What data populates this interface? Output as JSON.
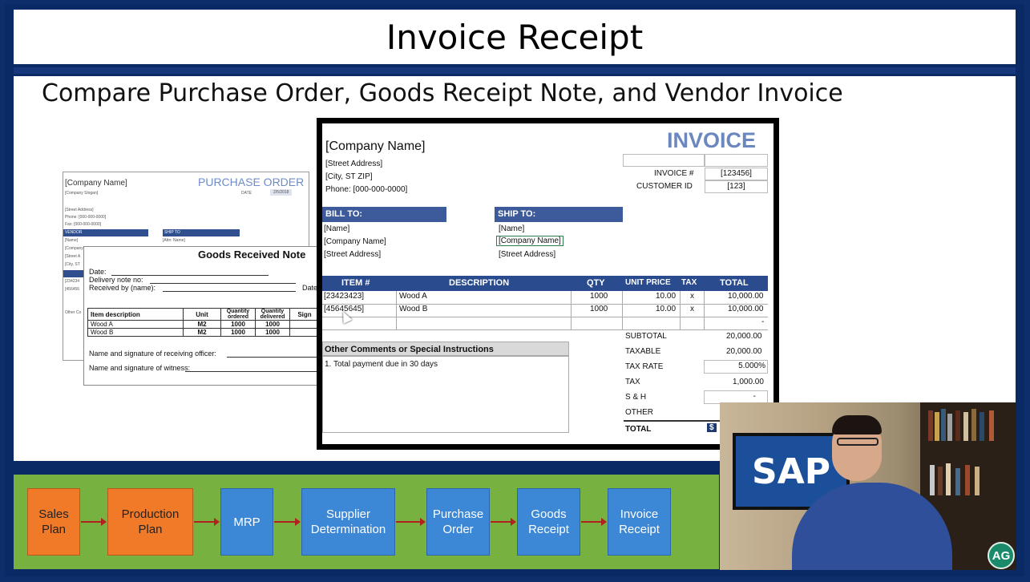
{
  "slide": {
    "title": "Invoice Receipt",
    "subtitle": "Compare Purchase Order, Goods Receipt Note, and Vendor Invoice"
  },
  "purchase_order": {
    "company": "[Company Name]",
    "heading": "PURCHASE ORDER",
    "slogan": "[Company Slogan]",
    "date_label": "DATE",
    "date_value": "2/5/2018",
    "street": "[Street Address]",
    "phone": "Phone: [000-000-0000]",
    "fax": "Fax: [000-000-0000]",
    "vendor_label": "VENDOR",
    "ship_to_label": "SHIP TO",
    "vendor_name": "[Name]",
    "ship_name": "[Attn: Name]",
    "vendor_company": "[Company",
    "vendor_street": "[Street A",
    "vendor_city": "[City, ST",
    "po_item_1": "[234234",
    "po_item_2": "[456456",
    "other": "Other Co"
  },
  "goods_received": {
    "heading": "Goods Received Note",
    "date_label": "Date:",
    "delivery_label": "Delivery note no:",
    "received_label": "Received by (name):",
    "date_right": "Date",
    "columns": [
      "Item description",
      "Unit",
      "Quantity ordered",
      "Quantity delivered",
      "Sign"
    ],
    "rows": [
      [
        "Wood A",
        "M2",
        "1000",
        "1000",
        ""
      ],
      [
        "Wood B",
        "M2",
        "1000",
        "1000",
        ""
      ]
    ],
    "sig_officer": "Name and signature of receiving officer:",
    "sig_witness": "Name and signature of witness:"
  },
  "invoice": {
    "heading": "INVOICE",
    "company": "[Company Name]",
    "street": "[Street Address]",
    "city": "[City, ST  ZIP]",
    "phone": "Phone: [000-000-0000]",
    "invoice_no_label": "INVOICE #",
    "invoice_no": "[123456]",
    "customer_id_label": "CUSTOMER ID",
    "customer_id": "[123]",
    "bill_to_label": "BILL TO:",
    "ship_to_label": "SHIP TO:",
    "bill_to": [
      "[Name]",
      "[Company Name]",
      "[Street Address]"
    ],
    "ship_to": [
      "[Name]",
      "[Company Name]",
      "[Street Address]"
    ],
    "columns": [
      "ITEM #",
      "DESCRIPTION",
      "QTY",
      "UNIT PRICE",
      "TAX",
      "TOTAL"
    ],
    "items": [
      {
        "item": "[23423423]",
        "desc": "Wood A",
        "qty": "1000",
        "price": "10.00",
        "tax": "x",
        "total": "10,000.00"
      },
      {
        "item": "[45645645]",
        "desc": "Wood B",
        "qty": "1000",
        "price": "10.00",
        "tax": "x",
        "total": "10,000.00"
      },
      {
        "item": "",
        "desc": "",
        "qty": "",
        "price": "",
        "tax": "",
        "total": "-"
      }
    ],
    "subtotal_label": "SUBTOTAL",
    "subtotal": "20,000.00",
    "taxable_label": "TAXABLE",
    "taxable": "20,000.00",
    "tax_rate_label": "TAX RATE",
    "tax_rate": "5.000%",
    "tax_label": "TAX",
    "tax": "1,000.00",
    "sh_label": "S & H",
    "sh": "-",
    "other_label": "OTHER",
    "total_label": "TOTAL",
    "total_partial": "$",
    "comments_label": "Other Comments or Special Instructions",
    "comment_1": "1. Total payment due in 30 days"
  },
  "flow": [
    {
      "label": "Sales\nPlan",
      "color": "#f07a28"
    },
    {
      "label": "Production\nPlan",
      "color": "#f07a28"
    },
    {
      "label": "MRP",
      "color": "#3c87d6"
    },
    {
      "label": "Supplier\nDetermination",
      "color": "#3c87d6"
    },
    {
      "label": "Purchase\nOrder",
      "color": "#3c87d6"
    },
    {
      "label": "Goods\nReceipt",
      "color": "#3c87d6"
    },
    {
      "label": "Invoice\nReceipt",
      "color": "#3c87d6"
    }
  ],
  "video": {
    "tv_logo": "SAP",
    "badge": "AG"
  }
}
